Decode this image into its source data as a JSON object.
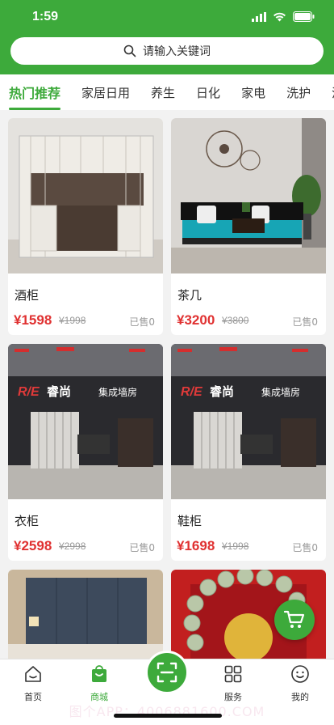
{
  "status": {
    "time": "1:59"
  },
  "search": {
    "placeholder": "请输入关键词"
  },
  "tabs": [
    "热门推荐",
    "家居日用",
    "养生",
    "日化",
    "家电",
    "洗护",
    "清"
  ],
  "products": [
    {
      "name": "酒柜",
      "price": "¥1598",
      "original_price": "¥1998",
      "sold": "已售0"
    },
    {
      "name": "茶几",
      "price": "¥3200",
      "original_price": "¥3800",
      "sold": "已售0"
    },
    {
      "name": "衣柜",
      "price": "¥2598",
      "original_price": "¥2998",
      "sold": "已售0"
    },
    {
      "name": "鞋柜",
      "price": "¥1698",
      "original_price": "¥1998",
      "sold": "已售0"
    }
  ],
  "store_signs": [
    {
      "logo": "R/E",
      "brand": "睿尚",
      "slogan": "集成墙房"
    },
    {
      "logo": "R/E",
      "brand": "睿尚",
      "slogan": "集成墙房"
    }
  ],
  "tabbar": {
    "home": "首页",
    "mall": "商城",
    "service": "服务",
    "mine": "我的"
  },
  "watermark": "图个APP：4006881600.COM",
  "colors": {
    "brand": "#3daa3b",
    "price": "#e03131"
  }
}
